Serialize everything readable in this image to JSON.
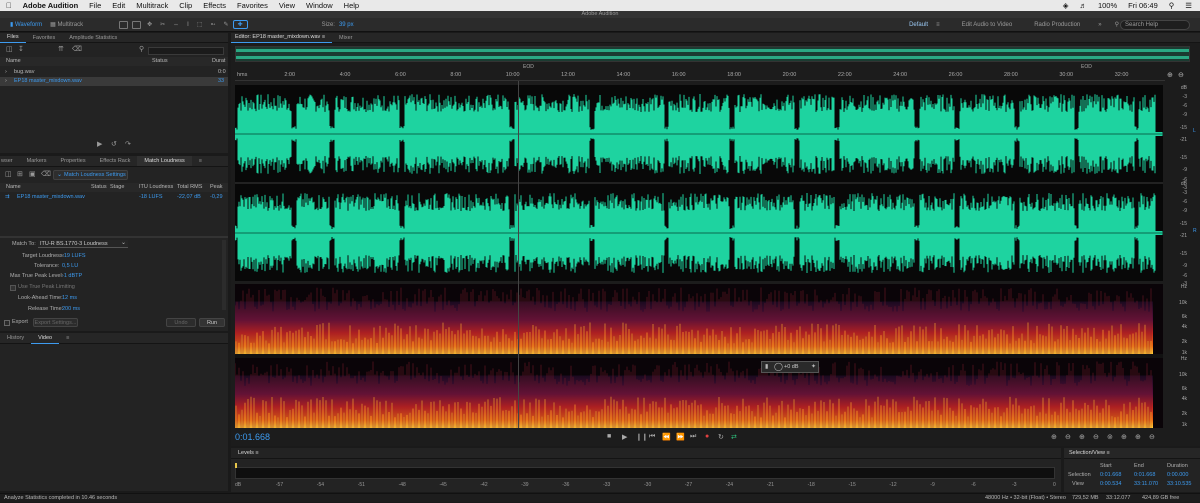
{
  "macbar": {
    "app": "Adobe Audition",
    "menus": [
      "File",
      "Edit",
      "Multitrack",
      "Clip",
      "Effects",
      "Favorites",
      "View",
      "Window",
      "Help"
    ],
    "battery": "100%",
    "clock": "Fri 06:49"
  },
  "window_title": "Adobe Audition",
  "toolbar": {
    "waveform": "Waveform",
    "multitrack": "Multitrack",
    "size_label": "Size:",
    "size_value": "39 px",
    "workspaces": [
      "Default",
      "Edit Audio to Video",
      "Radio Production"
    ],
    "search_placeholder": "Search Help"
  },
  "files_panel": {
    "tabs": [
      "Files",
      "Favorites",
      "Amplitude Statistics"
    ],
    "columns": [
      "Name",
      "Status",
      "Durat"
    ],
    "items": [
      {
        "name": "bug.wav",
        "duration": "0:0"
      },
      {
        "name": "EP18 master_mixdown.wav",
        "duration": "33"
      }
    ]
  },
  "match_panel": {
    "tabs": [
      "wser",
      "Markers",
      "Properties",
      "Effects Rack",
      "Match Loudness"
    ],
    "settings_label": "Match Loudness Settings",
    "columns": [
      "Name",
      "Status",
      "Stage",
      "ITU Loudness",
      "Total RMS",
      "Peak"
    ],
    "row": {
      "name": "EP18 master_mixdown.wav",
      "itu": "-18 LUFS",
      "rms": "-22,07 dB",
      "peak": "-0,29"
    },
    "match_to_label": "Match To:",
    "match_to_value": "ITU-R BS.1770-3 Loudness",
    "target_label": "Target Loudness:",
    "target_value": "-19 LUFS",
    "tolerance_label": "Tolerance:",
    "tolerance_value": "0,5 LU",
    "maxpeak_label": "Max True Peak Level:",
    "maxpeak_value": "-1 dBTP",
    "limiting_label": "Use True Peak Limiting",
    "lookahead_label": "Look-Ahead Time:",
    "lookahead_value": "12 ms",
    "release_label": "Release Time:",
    "release_value": "200 ms",
    "export_label": "Export",
    "export_settings": "Export Settings...",
    "undo": "Undo",
    "run": "Run"
  },
  "bottom_left_tabs": [
    "History",
    "Video"
  ],
  "editor": {
    "tab": "Editor: EP18 master_mixdown.wav",
    "mixer_tab": "Mixer",
    "eod": "EOD",
    "ruler": [
      "hms",
      "2:00",
      "4:00",
      "6:00",
      "8:00",
      "10:00",
      "12:00",
      "14:00",
      "16:00",
      "18:00",
      "20:00",
      "22:00",
      "24:00",
      "26:00",
      "28:00",
      "30:00",
      "32:00"
    ],
    "db_scale": [
      "dB",
      "-3",
      "-6",
      "-9",
      "-15",
      "-21",
      "-15",
      "-9",
      "-6",
      "-3"
    ],
    "hz_scale": [
      "Hz",
      "10k",
      "6k",
      "4k",
      "2k",
      "1k"
    ],
    "hud_value": "+0 dB",
    "time_display": "0:01.668"
  },
  "levels_panel": {
    "title": "Levels",
    "scale": [
      "dB",
      "-57",
      "-54",
      "-51",
      "-48",
      "-45",
      "-42",
      "-39",
      "-36",
      "-33",
      "-30",
      "-27",
      "-24",
      "-21",
      "-18",
      "-15",
      "-12",
      "-9",
      "-6",
      "-3",
      "0"
    ]
  },
  "selection_panel": {
    "title": "Selection/View",
    "headers": [
      "Start",
      "End",
      "Duration"
    ],
    "rows": [
      {
        "label": "Selection",
        "start": "0:01.668",
        "end": "0:01.668",
        "duration": "0:00.000"
      },
      {
        "label": "View",
        "start": "0:00.534",
        "end": "33:11.070",
        "duration": "33:10.535"
      }
    ]
  },
  "statusbar": {
    "left": "Analyze Statistics completed in 10.46 seconds",
    "format": "48000 Hz • 32-bit (Float) • Stereo",
    "size": "729,52 MB",
    "duration": "33:12.077",
    "free": "424,89 GB free"
  },
  "colors": {
    "accent": "#3d9bf0",
    "waveform": "#1ed3a0",
    "playhead": "#e8c74a"
  }
}
